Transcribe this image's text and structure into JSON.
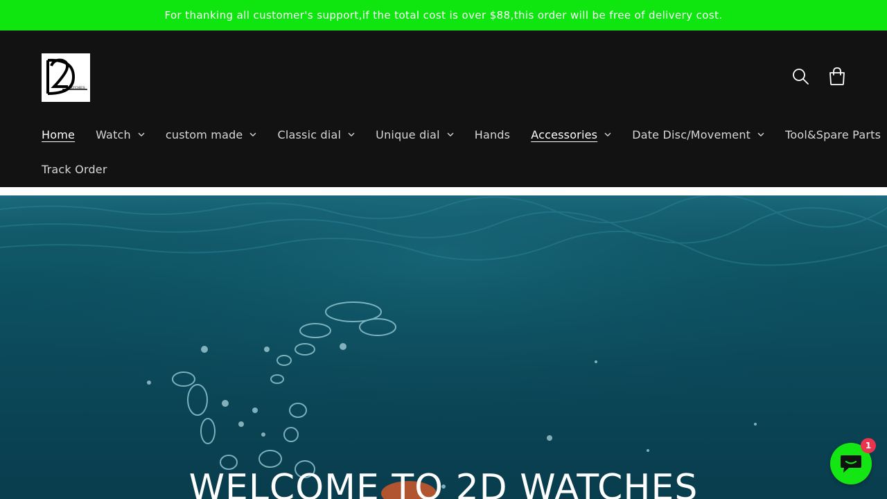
{
  "announcement": {
    "text": "For thanking all customer's support,if the total cost is over $88,this order will be free of delivery cost."
  },
  "header": {
    "logo_icon": "2d-watches-logo",
    "search_icon": "search-icon",
    "cart_icon": "cart-icon"
  },
  "nav": {
    "items": [
      {
        "label": "Home",
        "has_dropdown": false,
        "active": true
      },
      {
        "label": "Watch",
        "has_dropdown": true
      },
      {
        "label": "custom made",
        "has_dropdown": true
      },
      {
        "label": "Classic dial",
        "has_dropdown": true
      },
      {
        "label": "Unique dial",
        "has_dropdown": true
      },
      {
        "label": "Hands",
        "has_dropdown": false
      },
      {
        "label": "Accessories",
        "has_dropdown": true,
        "underlined": true
      },
      {
        "label": "Date Disc/Movement",
        "has_dropdown": true
      },
      {
        "label": "Tool&Spare Parts",
        "has_dropdown": false
      },
      {
        "label": "Track Order",
        "has_dropdown": false
      }
    ]
  },
  "hero": {
    "title": "WELCOME TO 2D WATCHES"
  },
  "chat": {
    "icon": "chat-icon",
    "badge_count": "1"
  },
  "colors": {
    "announcement_bg": "#0fe60f",
    "header_bg": "#121212",
    "chat_bg": "#14e614",
    "badge_bg": "#e8344e"
  }
}
